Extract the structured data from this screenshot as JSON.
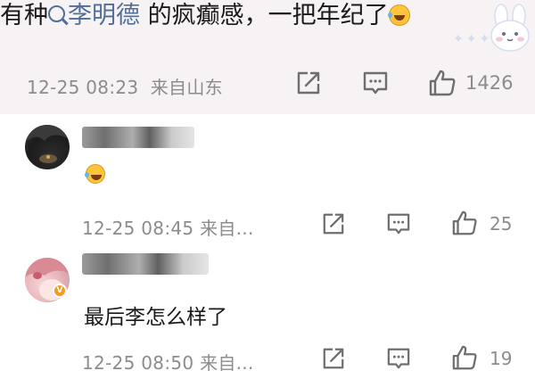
{
  "top_comment": {
    "text_before": "有种",
    "mention": "李明德",
    "text_after": " 的疯癫感，一把年纪了",
    "emoji": "laugh-cry-emoji",
    "time": "12-25 08:23",
    "source": "来自山东",
    "like_count": "1426"
  },
  "replies": [
    {
      "username": "",
      "emoji_only": "laugh-cry-emoji",
      "time_source": "12-25 08:45  来自...",
      "like_count": "25"
    },
    {
      "username": "",
      "text": "最后李怎么样了",
      "time_source": "12-25 08:50  来自...",
      "like_count": "19"
    }
  ],
  "icons": {
    "share": "share-icon",
    "comment": "comment-icon",
    "like": "thumbs-up-icon"
  },
  "colors": {
    "mention": "#4f6f9a",
    "meta": "#8c8c8c",
    "top_bg": "#f7f2f3"
  }
}
